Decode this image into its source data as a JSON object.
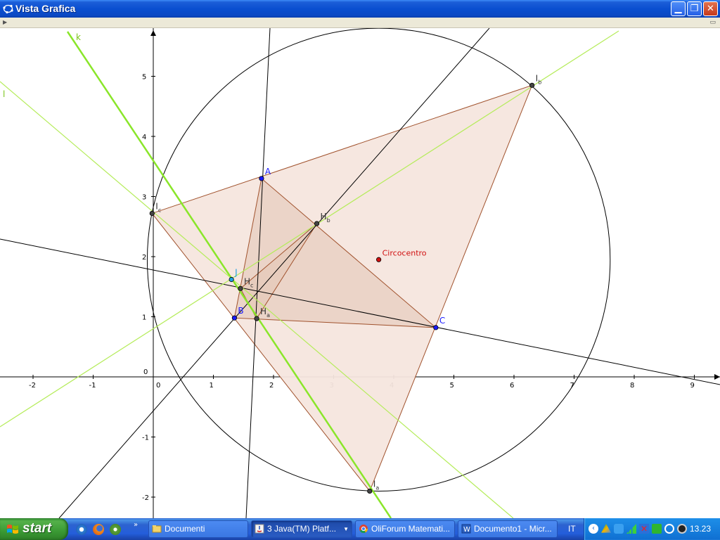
{
  "window": {
    "title": "Vista Grafica"
  },
  "axes": {
    "x_ticks": [
      -2,
      -1,
      0,
      1,
      2,
      3,
      4,
      5,
      6,
      7,
      8,
      9
    ],
    "y_ticks": [
      -2,
      -1,
      0,
      1,
      2,
      3,
      4,
      5
    ]
  },
  "points": {
    "A": {
      "label": "A",
      "x": 1.8,
      "y": 3.3,
      "color": "#1a1aff"
    },
    "B": {
      "label": "B",
      "x": 1.35,
      "y": 0.98,
      "color": "#1a1aff"
    },
    "C": {
      "label": "C",
      "x": 4.7,
      "y": 0.82,
      "color": "#1a1aff"
    },
    "Ia": {
      "label": "I",
      "sub": "a",
      "x": 3.6,
      "y": -1.9,
      "color": "#444444"
    },
    "Ib": {
      "label": "I",
      "sub": "b",
      "x": 6.3,
      "y": 4.85,
      "color": "#444444"
    },
    "Ic": {
      "label": "I",
      "sub": "c",
      "x": -0.02,
      "y": 2.72,
      "color": "#444444"
    },
    "Ha": {
      "label": "H",
      "sub": "a",
      "x": 1.72,
      "y": 0.97,
      "color": "#444444"
    },
    "Hb": {
      "label": "H",
      "sub": "b",
      "x": 2.72,
      "y": 2.55,
      "color": "#444444"
    },
    "Hc": {
      "label": "H",
      "sub": "c",
      "x": 1.45,
      "y": 1.47,
      "color": "#444444"
    },
    "J": {
      "label": "J",
      "x": 1.3,
      "y": 1.62,
      "color": "#1ea0e0"
    },
    "O": {
      "label": "Circocentro",
      "x": 3.75,
      "y": 1.95,
      "color": "#d01010"
    }
  },
  "circle": {
    "cx": 3.75,
    "cy": 1.95,
    "r": 3.85
  },
  "line_labels": {
    "k": "k",
    "l": "l"
  },
  "taskbar": {
    "start": "start",
    "tasks": [
      {
        "label": "Documenti"
      },
      {
        "label": "3 Java(TM) Platf..."
      },
      {
        "label": "OliForum Matemati..."
      },
      {
        "label": "Documento1 - Micr..."
      }
    ],
    "lang": "IT",
    "clock": "13.23"
  },
  "colors": {
    "accent": "#245edb",
    "fill": "#f1dcd2",
    "green": "#7ee020",
    "brown": "#a0522d"
  }
}
